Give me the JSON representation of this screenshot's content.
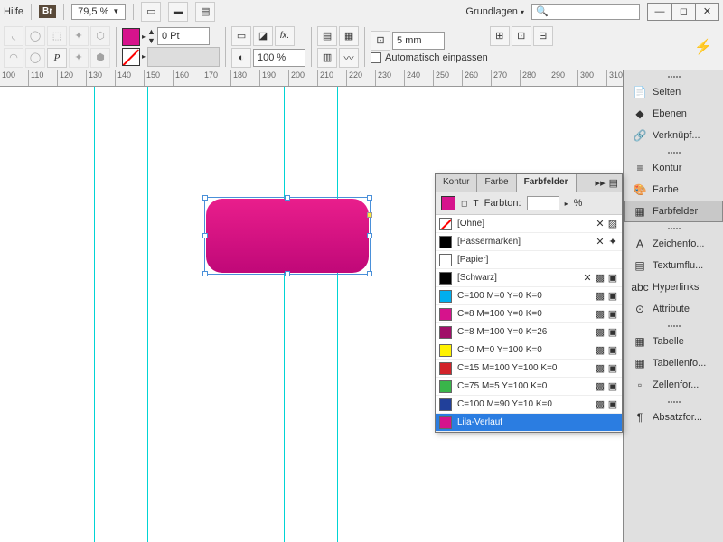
{
  "topbar": {
    "help": "Hilfe",
    "br": "Br",
    "zoom": "79,5 %",
    "workspace": "Grundlagen"
  },
  "toolbar": {
    "stroke_weight": "0 Pt",
    "opacity": "100 %",
    "inset": "5 mm",
    "autofit": "Automatisch einpassen"
  },
  "ruler": [
    "100",
    "110",
    "120",
    "130",
    "140",
    "150",
    "160",
    "170",
    "180",
    "190",
    "200",
    "210",
    "220",
    "230",
    "240",
    "250",
    "260",
    "270",
    "280",
    "290",
    "300",
    "310"
  ],
  "side": {
    "items": [
      {
        "icon": "📄",
        "label": "Seiten"
      },
      {
        "icon": "◆",
        "label": "Ebenen"
      },
      {
        "icon": "🔗",
        "label": "Verknüpf..."
      }
    ],
    "items2": [
      {
        "icon": "≡",
        "label": "Kontur"
      },
      {
        "icon": "🎨",
        "label": "Farbe"
      },
      {
        "icon": "▦",
        "label": "Farbfelder",
        "active": true
      }
    ],
    "items3": [
      {
        "icon": "A",
        "label": "Zeichenfo..."
      },
      {
        "icon": "▤",
        "label": "Textumflu..."
      },
      {
        "icon": "abc",
        "label": "Hyperlinks"
      },
      {
        "icon": "⊙",
        "label": "Attribute"
      }
    ],
    "items4": [
      {
        "icon": "▦",
        "label": "Tabelle"
      },
      {
        "icon": "▦",
        "label": "Tabellenfo..."
      },
      {
        "icon": "▫",
        "label": "Zellenfor..."
      }
    ],
    "items5": [
      {
        "icon": "¶",
        "label": "Absatzfor..."
      }
    ]
  },
  "swatches": {
    "tabs": [
      "Kontur",
      "Farbe",
      "Farbfelder"
    ],
    "tint_label": "Farbton:",
    "tint_unit": "%",
    "rows": [
      {
        "name": "[Ohne]",
        "color": "none",
        "flags": [
          "✕",
          "▨"
        ]
      },
      {
        "name": "[Passermarken]",
        "color": "#000",
        "flags": [
          "✕",
          "✦"
        ]
      },
      {
        "name": "[Papier]",
        "color": "#fff",
        "flags": [
          "",
          ""
        ]
      },
      {
        "name": "[Schwarz]",
        "color": "#000",
        "flags": [
          "✕",
          "▩",
          "▣"
        ]
      },
      {
        "name": "C=100 M=0 Y=0 K=0",
        "color": "#00aeef",
        "flags": [
          "▩",
          "▣"
        ]
      },
      {
        "name": "C=8 M=100 Y=0 K=0",
        "color": "#d6138c",
        "flags": [
          "▩",
          "▣"
        ]
      },
      {
        "name": "C=8 M=100 Y=0 K=26",
        "color": "#a00f68",
        "flags": [
          "▩",
          "▣"
        ]
      },
      {
        "name": "C=0 M=0 Y=100 K=0",
        "color": "#fff200",
        "flags": [
          "▩",
          "▣"
        ]
      },
      {
        "name": "C=15 M=100 Y=100 K=0",
        "color": "#d2232a",
        "flags": [
          "▩",
          "▣"
        ]
      },
      {
        "name": "C=75 M=5 Y=100 K=0",
        "color": "#39b54a",
        "flags": [
          "▩",
          "▣"
        ]
      },
      {
        "name": "C=100 M=90 Y=10 K=0",
        "color": "#21409a",
        "flags": [
          "▩",
          "▣"
        ]
      },
      {
        "name": "Lila-Verlauf",
        "color": "#d6138c",
        "flags": [
          "",
          ""
        ],
        "selected": true
      }
    ]
  }
}
